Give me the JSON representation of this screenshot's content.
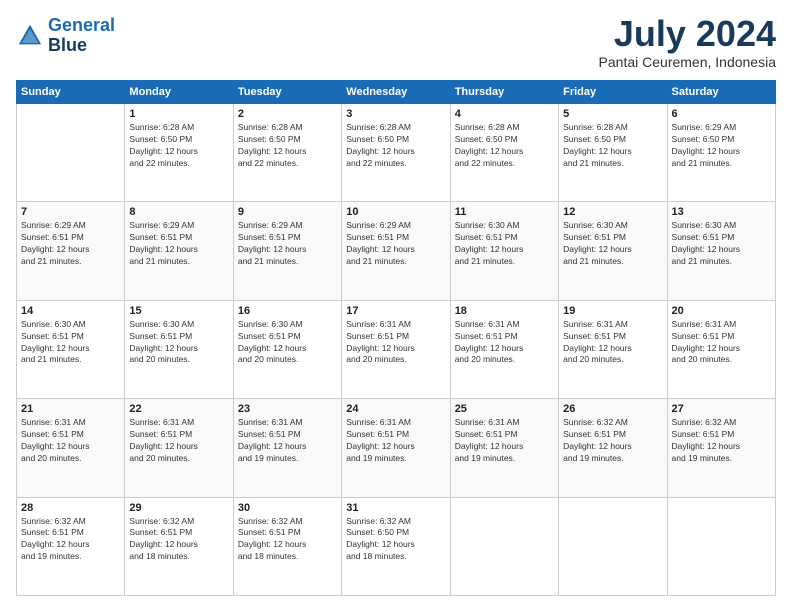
{
  "header": {
    "logo_line1": "General",
    "logo_line2": "Blue",
    "month_year": "July 2024",
    "location": "Pantai Ceuremen, Indonesia"
  },
  "weekdays": [
    "Sunday",
    "Monday",
    "Tuesday",
    "Wednesday",
    "Thursday",
    "Friday",
    "Saturday"
  ],
  "rows": [
    [
      {
        "day": "",
        "text": ""
      },
      {
        "day": "1",
        "text": "Sunrise: 6:28 AM\nSunset: 6:50 PM\nDaylight: 12 hours\nand 22 minutes."
      },
      {
        "day": "2",
        "text": "Sunrise: 6:28 AM\nSunset: 6:50 PM\nDaylight: 12 hours\nand 22 minutes."
      },
      {
        "day": "3",
        "text": "Sunrise: 6:28 AM\nSunset: 6:50 PM\nDaylight: 12 hours\nand 22 minutes."
      },
      {
        "day": "4",
        "text": "Sunrise: 6:28 AM\nSunset: 6:50 PM\nDaylight: 12 hours\nand 22 minutes."
      },
      {
        "day": "5",
        "text": "Sunrise: 6:28 AM\nSunset: 6:50 PM\nDaylight: 12 hours\nand 21 minutes."
      },
      {
        "day": "6",
        "text": "Sunrise: 6:29 AM\nSunset: 6:50 PM\nDaylight: 12 hours\nand 21 minutes."
      }
    ],
    [
      {
        "day": "7",
        "text": "Sunrise: 6:29 AM\nSunset: 6:51 PM\nDaylight: 12 hours\nand 21 minutes."
      },
      {
        "day": "8",
        "text": "Sunrise: 6:29 AM\nSunset: 6:51 PM\nDaylight: 12 hours\nand 21 minutes."
      },
      {
        "day": "9",
        "text": "Sunrise: 6:29 AM\nSunset: 6:51 PM\nDaylight: 12 hours\nand 21 minutes."
      },
      {
        "day": "10",
        "text": "Sunrise: 6:29 AM\nSunset: 6:51 PM\nDaylight: 12 hours\nand 21 minutes."
      },
      {
        "day": "11",
        "text": "Sunrise: 6:30 AM\nSunset: 6:51 PM\nDaylight: 12 hours\nand 21 minutes."
      },
      {
        "day": "12",
        "text": "Sunrise: 6:30 AM\nSunset: 6:51 PM\nDaylight: 12 hours\nand 21 minutes."
      },
      {
        "day": "13",
        "text": "Sunrise: 6:30 AM\nSunset: 6:51 PM\nDaylight: 12 hours\nand 21 minutes."
      }
    ],
    [
      {
        "day": "14",
        "text": "Sunrise: 6:30 AM\nSunset: 6:51 PM\nDaylight: 12 hours\nand 21 minutes."
      },
      {
        "day": "15",
        "text": "Sunrise: 6:30 AM\nSunset: 6:51 PM\nDaylight: 12 hours\nand 20 minutes."
      },
      {
        "day": "16",
        "text": "Sunrise: 6:30 AM\nSunset: 6:51 PM\nDaylight: 12 hours\nand 20 minutes."
      },
      {
        "day": "17",
        "text": "Sunrise: 6:31 AM\nSunset: 6:51 PM\nDaylight: 12 hours\nand 20 minutes."
      },
      {
        "day": "18",
        "text": "Sunrise: 6:31 AM\nSunset: 6:51 PM\nDaylight: 12 hours\nand 20 minutes."
      },
      {
        "day": "19",
        "text": "Sunrise: 6:31 AM\nSunset: 6:51 PM\nDaylight: 12 hours\nand 20 minutes."
      },
      {
        "day": "20",
        "text": "Sunrise: 6:31 AM\nSunset: 6:51 PM\nDaylight: 12 hours\nand 20 minutes."
      }
    ],
    [
      {
        "day": "21",
        "text": "Sunrise: 6:31 AM\nSunset: 6:51 PM\nDaylight: 12 hours\nand 20 minutes."
      },
      {
        "day": "22",
        "text": "Sunrise: 6:31 AM\nSunset: 6:51 PM\nDaylight: 12 hours\nand 20 minutes."
      },
      {
        "day": "23",
        "text": "Sunrise: 6:31 AM\nSunset: 6:51 PM\nDaylight: 12 hours\nand 19 minutes."
      },
      {
        "day": "24",
        "text": "Sunrise: 6:31 AM\nSunset: 6:51 PM\nDaylight: 12 hours\nand 19 minutes."
      },
      {
        "day": "25",
        "text": "Sunrise: 6:31 AM\nSunset: 6:51 PM\nDaylight: 12 hours\nand 19 minutes."
      },
      {
        "day": "26",
        "text": "Sunrise: 6:32 AM\nSunset: 6:51 PM\nDaylight: 12 hours\nand 19 minutes."
      },
      {
        "day": "27",
        "text": "Sunrise: 6:32 AM\nSunset: 6:51 PM\nDaylight: 12 hours\nand 19 minutes."
      }
    ],
    [
      {
        "day": "28",
        "text": "Sunrise: 6:32 AM\nSunset: 6:51 PM\nDaylight: 12 hours\nand 19 minutes."
      },
      {
        "day": "29",
        "text": "Sunrise: 6:32 AM\nSunset: 6:51 PM\nDaylight: 12 hours\nand 18 minutes."
      },
      {
        "day": "30",
        "text": "Sunrise: 6:32 AM\nSunset: 6:51 PM\nDaylight: 12 hours\nand 18 minutes."
      },
      {
        "day": "31",
        "text": "Sunrise: 6:32 AM\nSunset: 6:50 PM\nDaylight: 12 hours\nand 18 minutes."
      },
      {
        "day": "",
        "text": ""
      },
      {
        "day": "",
        "text": ""
      },
      {
        "day": "",
        "text": ""
      }
    ]
  ]
}
